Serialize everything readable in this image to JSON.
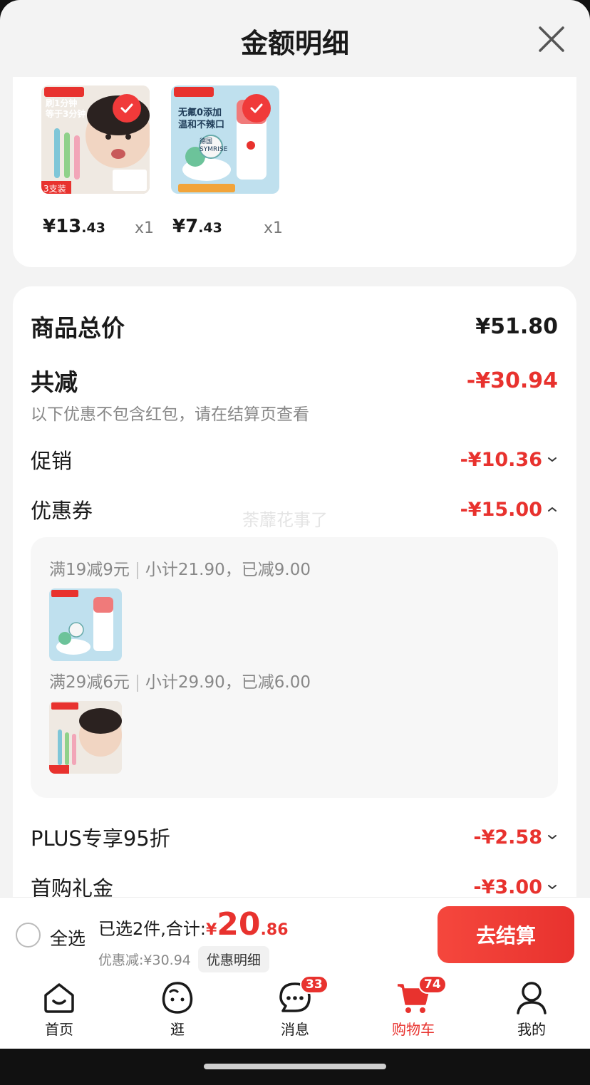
{
  "header": {
    "title": "金额明细"
  },
  "goods": [
    {
      "image_text": [
        "刷1分钟",
        "等于3分钟"
      ],
      "tag": "3支装",
      "price_int": "¥13",
      "price_dec": ".43",
      "qty": "x1"
    },
    {
      "image_text": [
        "无氟0添加",
        "温和不辣口"
      ],
      "tag": "德国 SYMRISE",
      "price_int": "¥7",
      "price_dec": ".43",
      "qty": "x1"
    }
  ],
  "detail": {
    "total_label": "商品总价",
    "total_value": "¥51.80",
    "reduce_label": "共减",
    "reduce_value": "-¥30.94",
    "reduce_note": "以下优惠不包含红包，请在结算页查看",
    "promo_label": "促销",
    "promo_value": "-¥10.36",
    "coupon_label": "优惠券",
    "coupon_value": "-¥15.00",
    "coupons": [
      {
        "rule": "满19减9元",
        "info": "小计21.90，已减9.00"
      },
      {
        "rule": "满29减6元",
        "info": "小计29.90，已减6.00"
      }
    ],
    "plus_label": "PLUS专享95折",
    "plus_value": "-¥2.58",
    "first_label": "首购礼金",
    "first_value": "-¥3.00"
  },
  "watermark": "荼蘼花事了",
  "bottom": {
    "select_all": "全选",
    "selected_text": "已选2件,合计:",
    "total_currency": "¥",
    "total_int": "20",
    "total_dec": ".86",
    "discount_text": "优惠减:¥30.94",
    "discount_detail_btn": "优惠明细",
    "checkout_label": "去结算"
  },
  "tabs": [
    {
      "label": "首页",
      "icon": "home-icon"
    },
    {
      "label": "逛",
      "icon": "browse-icon"
    },
    {
      "label": "消息",
      "icon": "message-icon",
      "badge": "33"
    },
    {
      "label": "购物车",
      "icon": "cart-icon",
      "badge": "74",
      "active": true
    },
    {
      "label": "我的",
      "icon": "profile-icon"
    }
  ],
  "colors": {
    "accent": "#e8322e",
    "background": "#f3f3f3"
  }
}
